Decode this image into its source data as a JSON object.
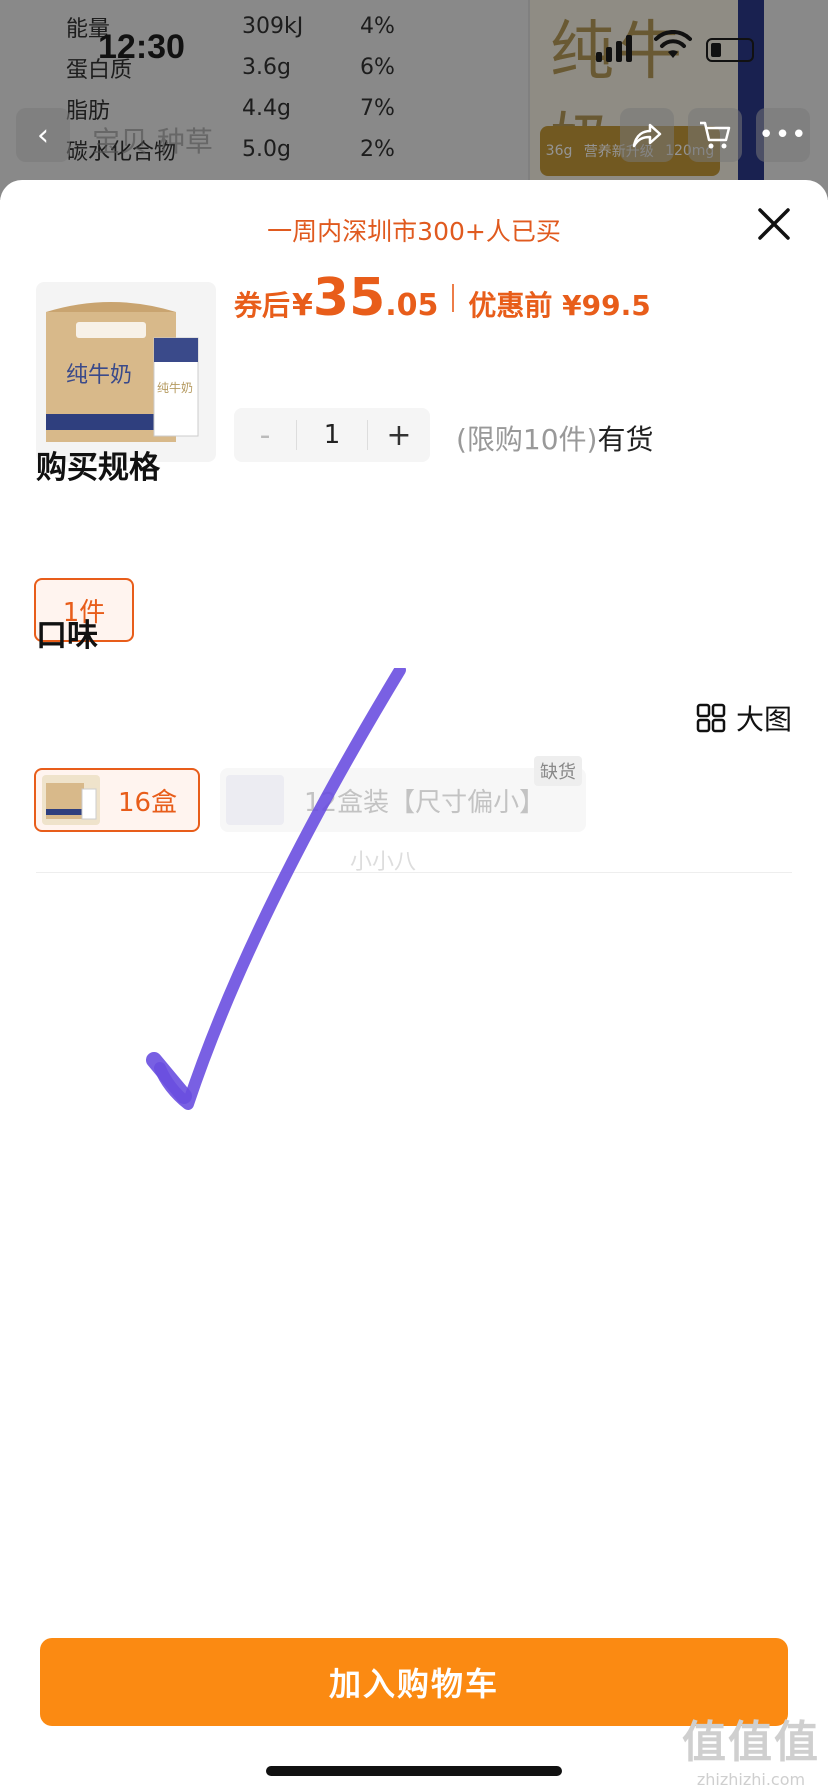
{
  "background": {
    "nutrition": [
      {
        "name": "能量",
        "amount": "309kJ",
        "nrv": "4%"
      },
      {
        "name": "蛋白质",
        "amount": "3.6g",
        "nrv": "6%"
      },
      {
        "name": "脂肪",
        "amount": "4.4g",
        "nrv": "7%"
      },
      {
        "name": "碳水化合物",
        "amount": "5.0g",
        "nrv": "2%"
      }
    ],
    "carton_title": "纯牛奶",
    "carton_badge": [
      "36g",
      "营养新升级",
      "120mg"
    ],
    "nav_title": "宝贝 种草"
  },
  "status": {
    "time": "12:30"
  },
  "sheet": {
    "social_proof": "一周内深圳市300+人已买",
    "price": {
      "coupon_label": "券后",
      "currency": "¥",
      "integer": "35",
      "decimal": ".05",
      "original_label": "优惠前 ¥99.5"
    },
    "quantity": "1",
    "minus": "-",
    "plus": "+",
    "limit_text": "(限购10件)",
    "availability": "有货",
    "spec_title": "购买规格",
    "spec_option": "1件",
    "flavor_title": "口味",
    "big_view": "大图",
    "flavor_options": [
      {
        "label": "16盒",
        "selected": true
      },
      {
        "label": "12盒装【尺寸偏小】",
        "out_of_stock": "缺货"
      }
    ],
    "faint_text": "小小八",
    "add_to_cart": "加入购物车"
  },
  "watermark": {
    "big": "值值值",
    "small": "zhizhizhi.com"
  },
  "colors": {
    "accent": "#e85d1a",
    "cart_button": "#fb8a12",
    "checkmark": "#6a4fe0"
  }
}
